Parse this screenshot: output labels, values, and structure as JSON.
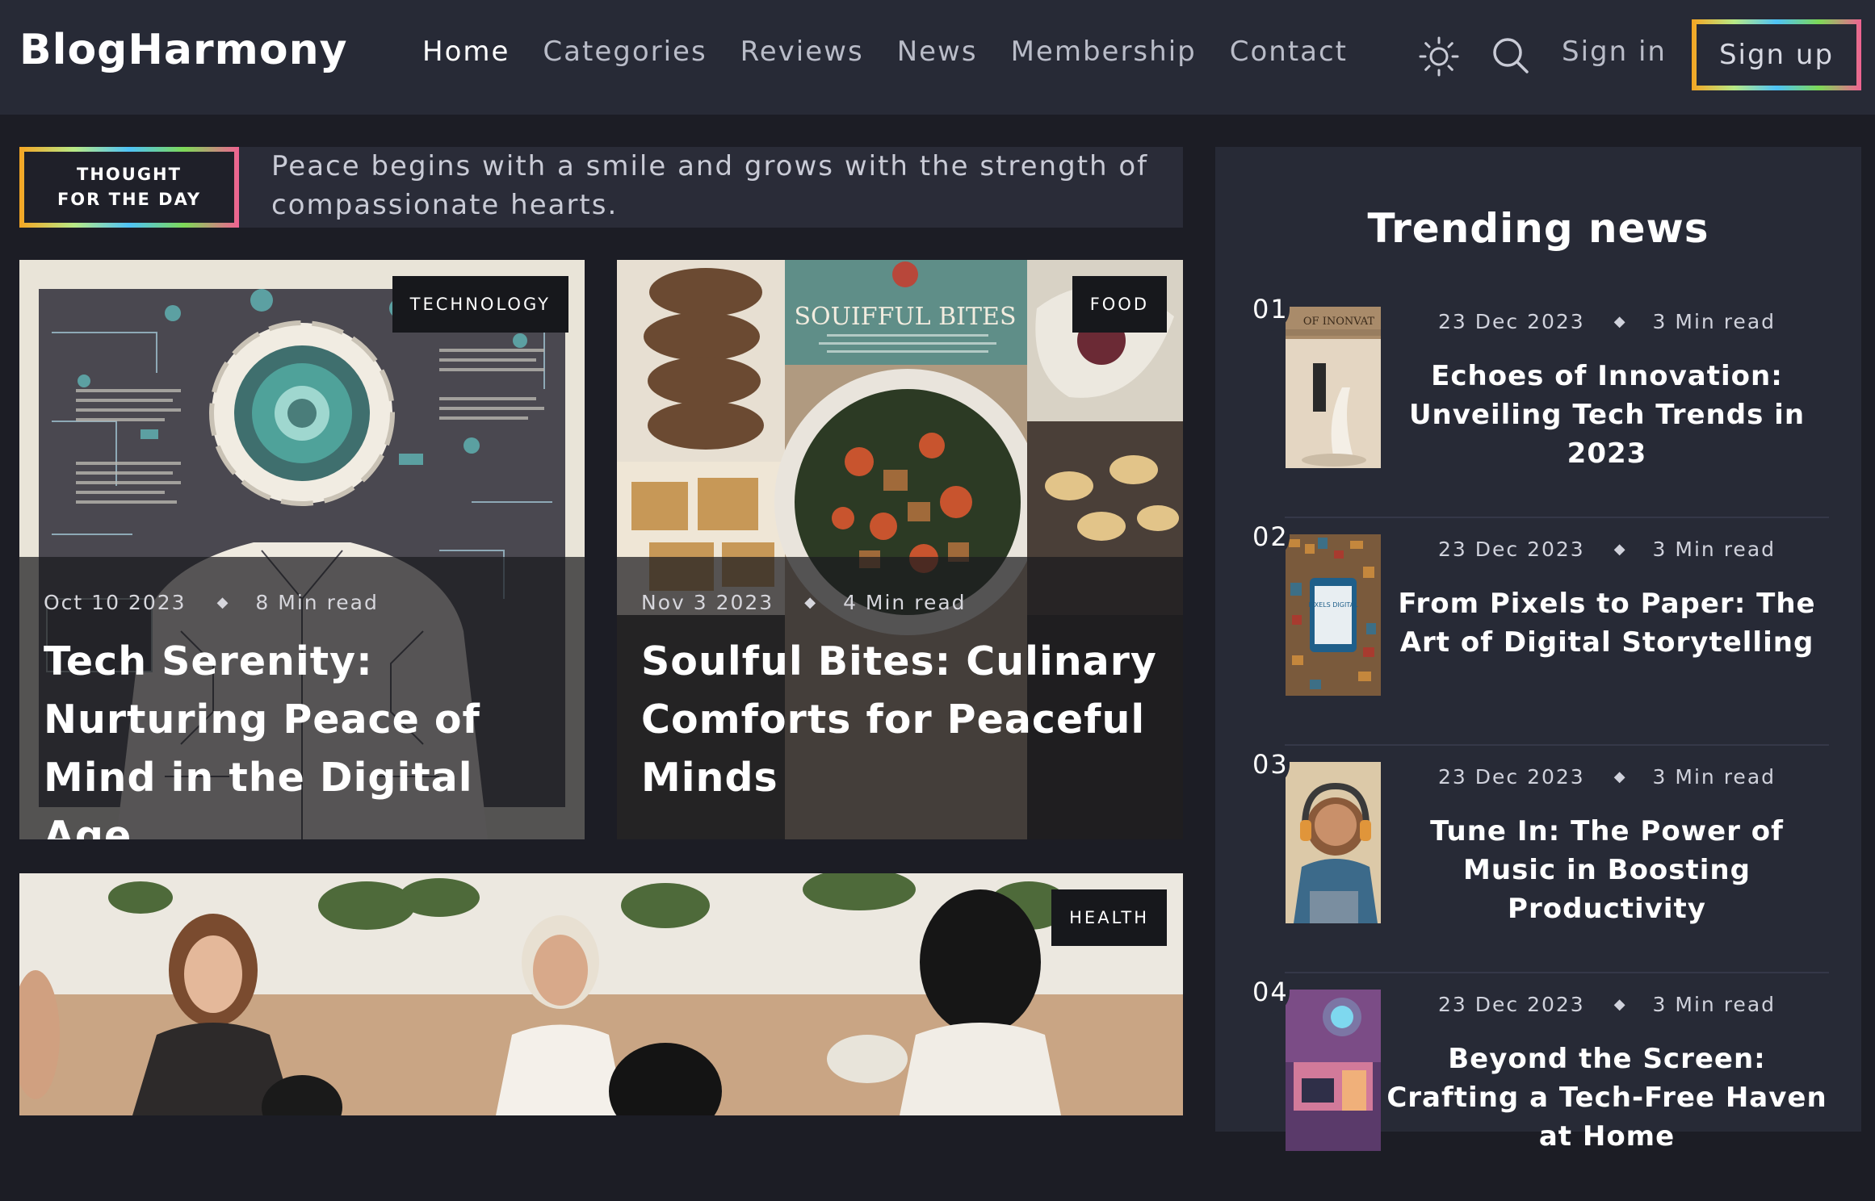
{
  "header": {
    "logo": "BlogHarmony",
    "nav": [
      {
        "label": "Home",
        "active": true
      },
      {
        "label": "Categories"
      },
      {
        "label": "Reviews"
      },
      {
        "label": "News"
      },
      {
        "label": "Membership"
      },
      {
        "label": "Contact"
      }
    ],
    "theme_icon": "sun-icon",
    "search_icon": "search-icon",
    "sign_in": "Sign in",
    "sign_up": "Sign up"
  },
  "thought": {
    "label": "THOUGHT FOR THE DAY",
    "text": "Peace begins with a smile and grows with the strength of compassionate hearts."
  },
  "featured": [
    {
      "category": "TECHNOLOGY",
      "date": "Oct 10 2023",
      "read_time": "8 Min read",
      "title": "Tech Serenity: Nurturing Peace of Mind in the Digital Age"
    },
    {
      "category": "FOOD",
      "date": "Nov 3 2023",
      "read_time": "4 Min read",
      "title": "Soulful Bites: Culinary Comforts for Peaceful Minds",
      "cookbook_title": "SOUIFFUL BITES"
    },
    {
      "category": "HEALTH"
    }
  ],
  "sidebar": {
    "title": "Trending news",
    "items": [
      {
        "num": "01",
        "date": "23 Dec 2023",
        "read_time": "3 Min read",
        "title": "Echoes of Innovation: Unveiling Tech Trends in 2023",
        "thumb_text": "OF INONVAT"
      },
      {
        "num": "02",
        "date": "23 Dec 2023",
        "read_time": "3 Min read",
        "title": "From Pixels to Paper: The Art of Digital Storytelling",
        "thumb_text": "PIXELS DIGITAL"
      },
      {
        "num": "03",
        "date": "23 Dec 2023",
        "read_time": "3 Min read",
        "title": "Tune In: The Power of Music in Boosting Productivity"
      },
      {
        "num": "04",
        "date": "23 Dec 2023",
        "read_time": "3 Min read",
        "title": "Beyond the Screen: Crafting a Tech-Free Haven at Home"
      }
    ]
  },
  "colors": {
    "background": "#1c1d25",
    "panel": "#272a36",
    "gradient_border": [
      "#f5a623",
      "#b8e986",
      "#4fc3f7",
      "#7ed957",
      "#f06292"
    ]
  }
}
